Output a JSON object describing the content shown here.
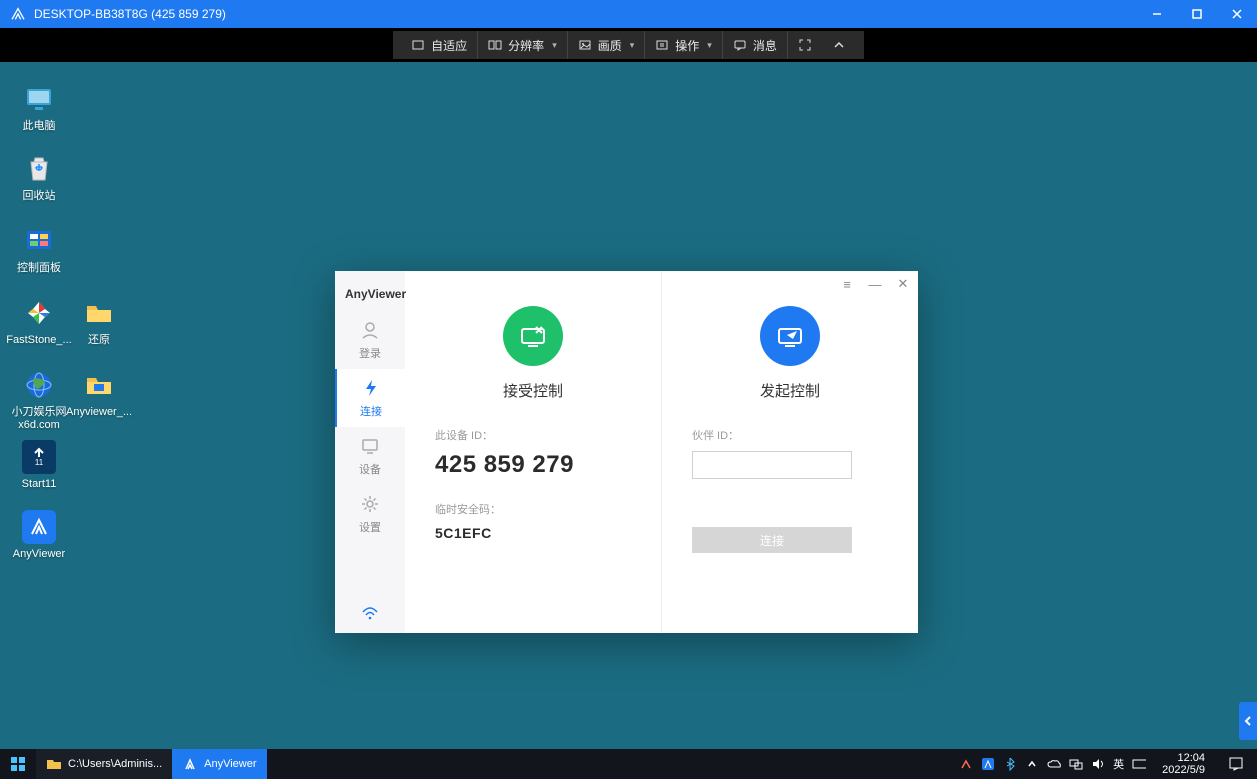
{
  "titlebar": {
    "title": "DESKTOP-BB38T8G (425 859 279)"
  },
  "toolbar": {
    "fit": "自适应",
    "resolution": "分辨率",
    "quality": "画质",
    "operate": "操作",
    "message": "消息"
  },
  "desktop_icons": [
    {
      "name": "computer",
      "label": "此电脑"
    },
    {
      "name": "recycle-bin",
      "label": "回收站"
    },
    {
      "name": "control-panel",
      "label": "控制面板"
    },
    {
      "name": "faststone",
      "label": "FastStone_..."
    },
    {
      "name": "restore",
      "label": "还原"
    },
    {
      "name": "xiaodao",
      "label": "小刀娱乐网x6d.com"
    },
    {
      "name": "anyviewer-shortcut",
      "label": "Anyviewer_..."
    },
    {
      "name": "start11",
      "label": "Start11"
    },
    {
      "name": "anyviewer",
      "label": "AnyViewer"
    }
  ],
  "app": {
    "brand": "AnyViewer",
    "nav": {
      "login": "登录",
      "connect": "连接",
      "device": "设备",
      "settings": "设置"
    },
    "left": {
      "title": "接受控制",
      "device_id_label": "此设备 ID：",
      "device_id": "425 859 279",
      "sec_code_label": "临时安全码：",
      "sec_code": "5C1EFC"
    },
    "right": {
      "title": "发起控制",
      "partner_label": "伙伴 ID：",
      "partner_value": "",
      "connect_btn": "连接"
    }
  },
  "taskbar": {
    "items": [
      {
        "name": "explorer",
        "label": "C:\\Users\\Adminis..."
      },
      {
        "name": "anyviewer",
        "label": "AnyViewer"
      }
    ],
    "ime": "英",
    "time": "12:04",
    "date": "2022/5/9"
  }
}
